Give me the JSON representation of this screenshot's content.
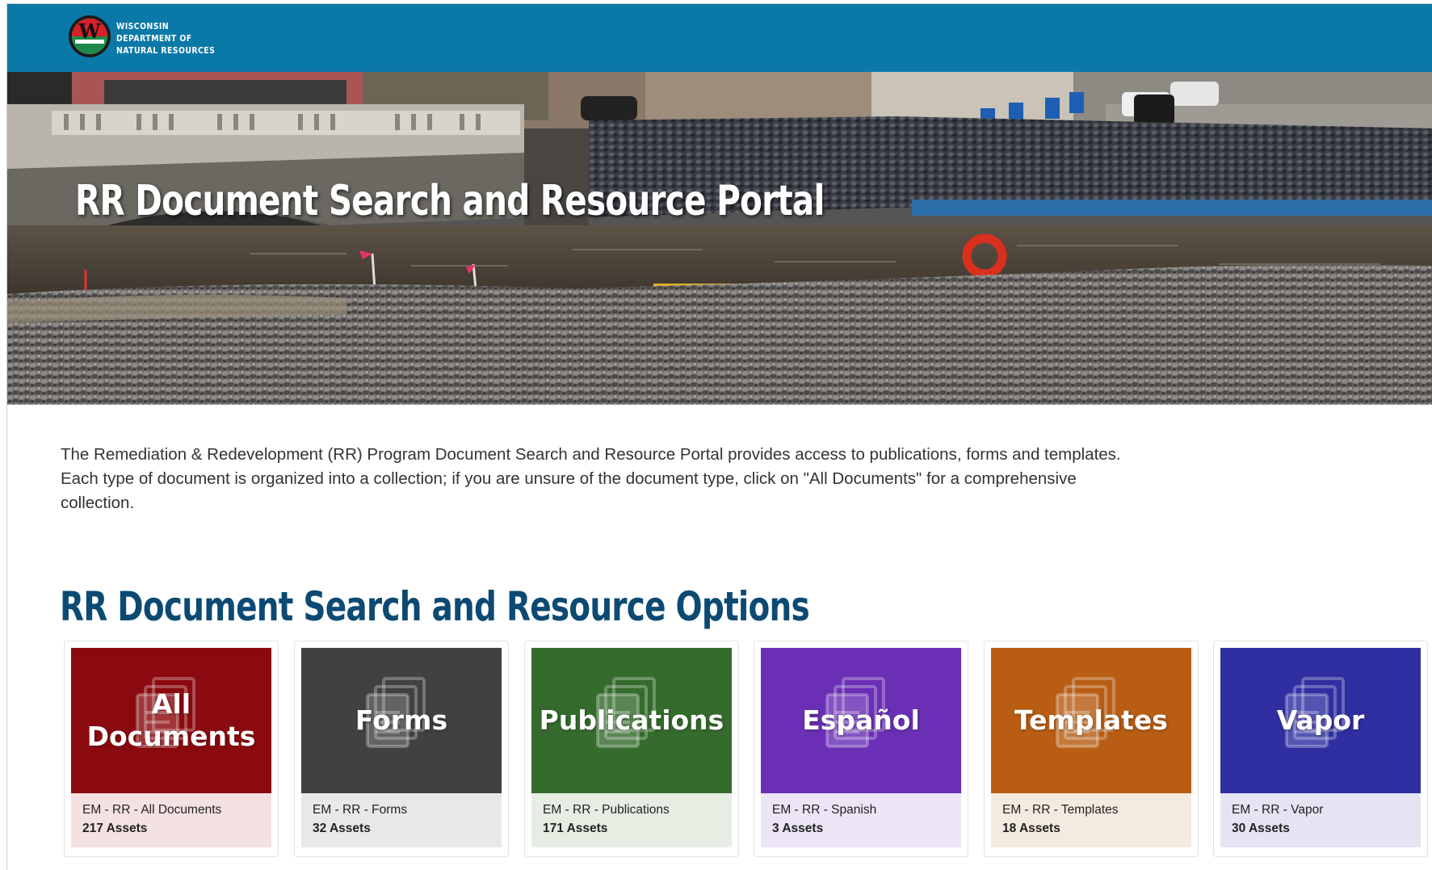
{
  "header": {
    "org_name": "WISCONSIN\nDEPARTMENT OF\nNATURAL RESOURCES",
    "logo_letter": "W",
    "bar_color": "#0a79a8"
  },
  "hero": {
    "title": "RR Document Search and Resource Portal"
  },
  "intro": {
    "text": "The Remediation & Redevelopment (RR) Program Document Search and Resource Portal provides access to publications, forms and templates. Each type of document is organized into a collection; if you are unsure of the document type, click on \"All Documents\" for a comprehensive collection."
  },
  "section": {
    "title": "RR Document Search and Resource Options"
  },
  "cards": [
    {
      "label": "All Documents",
      "name": "EM - RR - All Documents",
      "count": "217 Assets",
      "color": "#8b0a0f",
      "meta_bg": "#f4e2e2",
      "icon": "documents-icon"
    },
    {
      "label": "Forms",
      "name": "EM - RR - Forms",
      "count": "32 Assets",
      "color": "#414141",
      "meta_bg": "#e8e8e8",
      "icon": "documents-icon"
    },
    {
      "label": "Publications",
      "name": "EM - RR - Publications",
      "count": "171 Assets",
      "color": "#356b2d",
      "meta_bg": "#e6eee4",
      "icon": "documents-icon"
    },
    {
      "label": "Español",
      "name": "EM - RR - Spanish",
      "count": "3 Assets",
      "color": "#6a2fb5",
      "meta_bg": "#ece5f5",
      "icon": "documents-icon"
    },
    {
      "label": "Templates",
      "name": "EM - RR - Templates",
      "count": "18 Assets",
      "color": "#b85d13",
      "meta_bg": "#f5eadf",
      "icon": "documents-icon"
    },
    {
      "label": "Vapor",
      "name": "EM - RR - Vapor",
      "count": "30 Assets",
      "color": "#2f2fa1",
      "meta_bg": "#e4e4f2",
      "icon": "documents-icon"
    }
  ]
}
